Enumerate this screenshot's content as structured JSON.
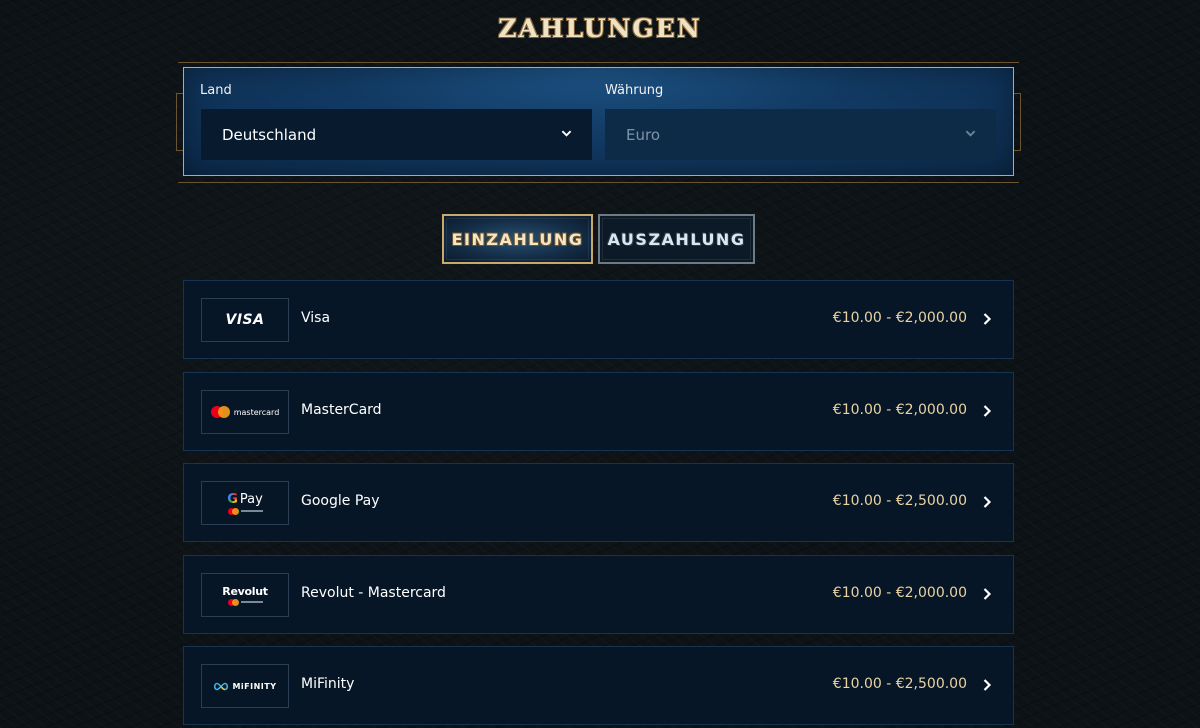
{
  "page": {
    "title": "ZAHLUNGEN"
  },
  "filters": {
    "country": {
      "label": "Land",
      "value": "Deutschland"
    },
    "currency": {
      "label": "Währung",
      "value": "Euro"
    }
  },
  "tabs": [
    {
      "label": "EINZAHLUNG",
      "active": true
    },
    {
      "label": "AUSZAHLUNG",
      "active": false
    }
  ],
  "methods": [
    {
      "name": "Visa",
      "logo_text": "VISA",
      "range": "€10.00 - €2,000.00"
    },
    {
      "name": "MasterCard",
      "logo_text": "mastercard",
      "range": "€10.00 - €2,000.00"
    },
    {
      "name": "Google Pay",
      "logo_text": "Pay",
      "range": "€10.00 - €2,500.00"
    },
    {
      "name": "Revolut - Mastercard",
      "logo_text": "Revolut",
      "range": "€10.00 - €2,000.00"
    },
    {
      "name": "MiFinity",
      "logo_text": "MiFINITY",
      "range": "€10.00 - €2,500.00"
    }
  ],
  "colors": {
    "gold": "#c8a86b",
    "panel_blue": "#123a63",
    "row_bg": "#061627",
    "range_text": "#e9d3a3",
    "mastercard_red": "#eb001b",
    "mastercard_orange": "#f79e1b"
  },
  "icons": {
    "dropdown": "chevron-down-icon",
    "row_arrow": "chevron-right-icon"
  }
}
